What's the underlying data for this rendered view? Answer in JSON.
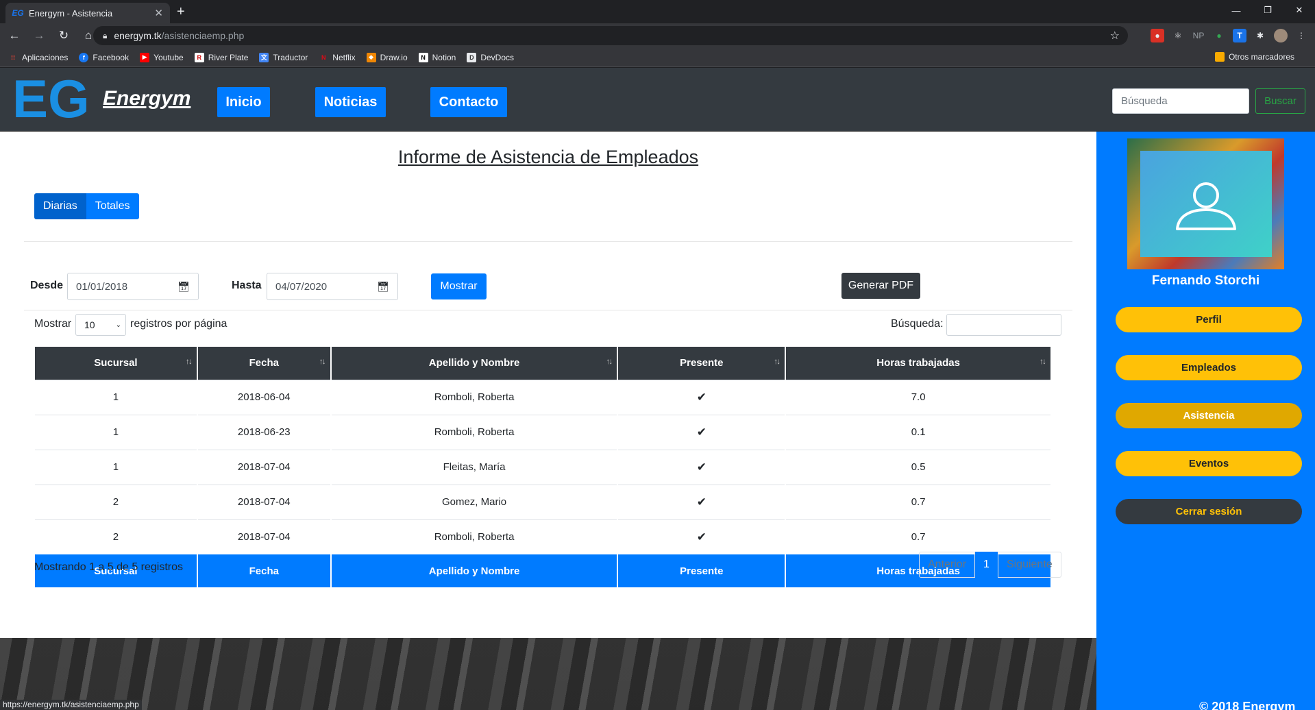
{
  "browser": {
    "tab_title": "Energym - Asistencia",
    "tab_favicon": "EG",
    "url_host": "energym.tk",
    "url_path": "/asistenciaemp.php",
    "status_url": "https://energym.tk/asistenciaemp.php",
    "ext_np": "NP",
    "ext_t": "T",
    "bookmarks": [
      {
        "label": "Aplicaciones",
        "icon": "apps-grid",
        "color": "#ea4335",
        "glyph": "⋮"
      },
      {
        "label": "Facebook",
        "icon": "facebook",
        "color": "#1877f2",
        "glyph": "f"
      },
      {
        "label": "Youtube",
        "icon": "youtube",
        "color": "#ff0000",
        "glyph": "▶"
      },
      {
        "label": "River Plate",
        "icon": "river-plate",
        "color": "#ffffff",
        "glyph": "R"
      },
      {
        "label": "Traductor",
        "icon": "translate",
        "color": "#4285f4",
        "glyph": "文"
      },
      {
        "label": "Netflix",
        "icon": "netflix",
        "color": "#e50914",
        "glyph": "N"
      },
      {
        "label": "Draw.io",
        "icon": "drawio",
        "color": "#f08705",
        "glyph": "◆"
      },
      {
        "label": "Notion",
        "icon": "notion",
        "color": "#ffffff",
        "glyph": "N"
      },
      {
        "label": "DevDocs",
        "icon": "devdocs",
        "color": "#e8eaed",
        "glyph": "D"
      }
    ],
    "other_bookmarks": "Otros marcadores"
  },
  "site": {
    "logo_mark": "EG",
    "logo_text": "Energym",
    "nav": [
      "Inicio",
      "Noticias",
      "Contacto"
    ],
    "search_placeholder": "Búsqueda",
    "search_button": "Buscar"
  },
  "report": {
    "title": "Informe de Asistencia de Empleados",
    "view_buttons": [
      "Diarias",
      "Totales"
    ],
    "from_label": "Desde",
    "from_value": "01/01/2018",
    "to_label": "Hasta",
    "to_value": "04/07/2020",
    "show_button": "Mostrar",
    "pdf_button": "Generar PDF",
    "length_prefix": "Mostrar",
    "length_value": "10",
    "length_suffix": "registros por página",
    "filter_label": "Búsqueda:",
    "columns": [
      "Sucursal",
      "Fecha",
      "Apellido y Nombre",
      "Presente",
      "Horas trabajadas"
    ],
    "rows": [
      {
        "sucursal": "1",
        "fecha": "2018-06-04",
        "nombre": "Romboli, Roberta",
        "presente": "✔",
        "horas": "7.0"
      },
      {
        "sucursal": "1",
        "fecha": "2018-06-23",
        "nombre": "Romboli, Roberta",
        "presente": "✔",
        "horas": "0.1"
      },
      {
        "sucursal": "1",
        "fecha": "2018-07-04",
        "nombre": "Fleitas, María",
        "presente": "✔",
        "horas": "0.5"
      },
      {
        "sucursal": "2",
        "fecha": "2018-07-04",
        "nombre": "Gomez, Mario",
        "presente": "✔",
        "horas": "0.7"
      },
      {
        "sucursal": "2",
        "fecha": "2018-07-04",
        "nombre": "Romboli, Roberta",
        "presente": "✔",
        "horas": "0.7"
      }
    ],
    "info": "Mostrando 1 a 5 de 5 registros",
    "pager": {
      "prev": "Anterior",
      "current": "1",
      "next": "Siguiente"
    }
  },
  "sidebar": {
    "user_name": "Fernando Storchi",
    "menu": [
      "Perfil",
      "Empleados",
      "Asistencia",
      "Eventos",
      "Cerrar sesión"
    ],
    "active": "Asistencia"
  },
  "footer": {
    "copyright": "© 2018 Energym"
  },
  "colors": {
    "primary": "#007bff",
    "dark": "#343a40",
    "warning": "#ffc107",
    "success": "#28a745"
  }
}
